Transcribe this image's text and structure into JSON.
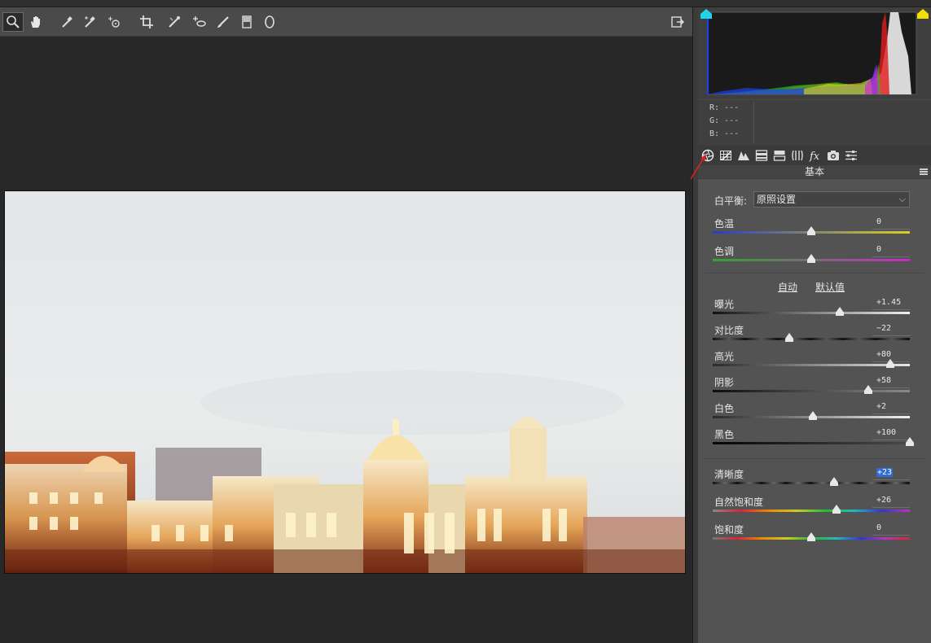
{
  "toolbar": {
    "tools": [
      "zoom-icon",
      "hand-icon",
      "eyedropper-icon",
      "color-sampler-icon",
      "target-adjust-icon",
      "crop-icon",
      "straighten-icon",
      "spot-removal-icon",
      "red-eye-icon",
      "brush-icon",
      "graduated-filter-icon",
      "radial-filter-icon"
    ],
    "export_icon": "open-export-icon"
  },
  "histogram": {
    "colors": {
      "shadow_clip": "#22d3e8",
      "highlight_clip": "#f2e100"
    }
  },
  "rgb": {
    "r": "R: ---",
    "g": "G: ---",
    "b": "B: ---"
  },
  "tabs": [
    "basic-icon",
    "tone-curve-icon",
    "detail-icon",
    "hsl-icon",
    "split-toning-icon",
    "lens-icon",
    "effects-icon",
    "camera-calibration-icon",
    "presets-icon"
  ],
  "section": {
    "title": "基本"
  },
  "white_balance": {
    "label": "白平衡:",
    "value": "原照设置"
  },
  "wb_sliders": [
    {
      "label": "色温",
      "value": "0",
      "level": 0.5
    },
    {
      "label": "色调",
      "value": "0",
      "level": 0.5
    }
  ],
  "auto": {
    "auto_label": "自动",
    "default_label": "默认值"
  },
  "tone_sliders": [
    {
      "label": "曝光",
      "value": "+1.45",
      "level": 0.645
    },
    {
      "label": "对比度",
      "value": "−22",
      "level": 0.39
    },
    {
      "label": "高光",
      "value": "+80",
      "level": 0.9
    },
    {
      "label": "阴影",
      "value": "+58",
      "level": 0.79
    },
    {
      "label": "白色",
      "value": "+2",
      "level": 0.51
    },
    {
      "label": "黑色",
      "value": "+100",
      "level": 1.0
    }
  ],
  "presence_sliders": [
    {
      "label": "清晰度",
      "value": "+23",
      "level": 0.615
    },
    {
      "label": "自然饱和度",
      "value": "+26",
      "level": 0.63
    },
    {
      "label": "饱和度",
      "value": "0",
      "level": 0.5
    }
  ]
}
